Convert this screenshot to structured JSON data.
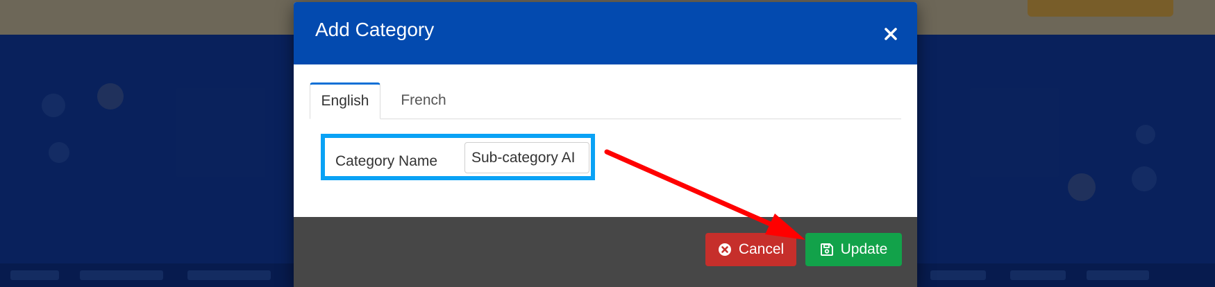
{
  "modal": {
    "title": "Add Category",
    "tabs": [
      {
        "label": "English",
        "active": true
      },
      {
        "label": "French",
        "active": false
      }
    ],
    "form": {
      "category_name_label": "Category Name",
      "category_name_value": "Sub-category AI"
    },
    "footer": {
      "cancel_label": "Cancel",
      "update_label": "Update"
    }
  },
  "colors": {
    "header": "#034aaf",
    "footer": "#474747",
    "cancel": "#c62f2b",
    "update": "#12a24a",
    "highlight": "#0aa2f5",
    "arrow": "#ff0000"
  },
  "icons": [
    "close-icon",
    "times-circle-icon",
    "save-icon"
  ]
}
